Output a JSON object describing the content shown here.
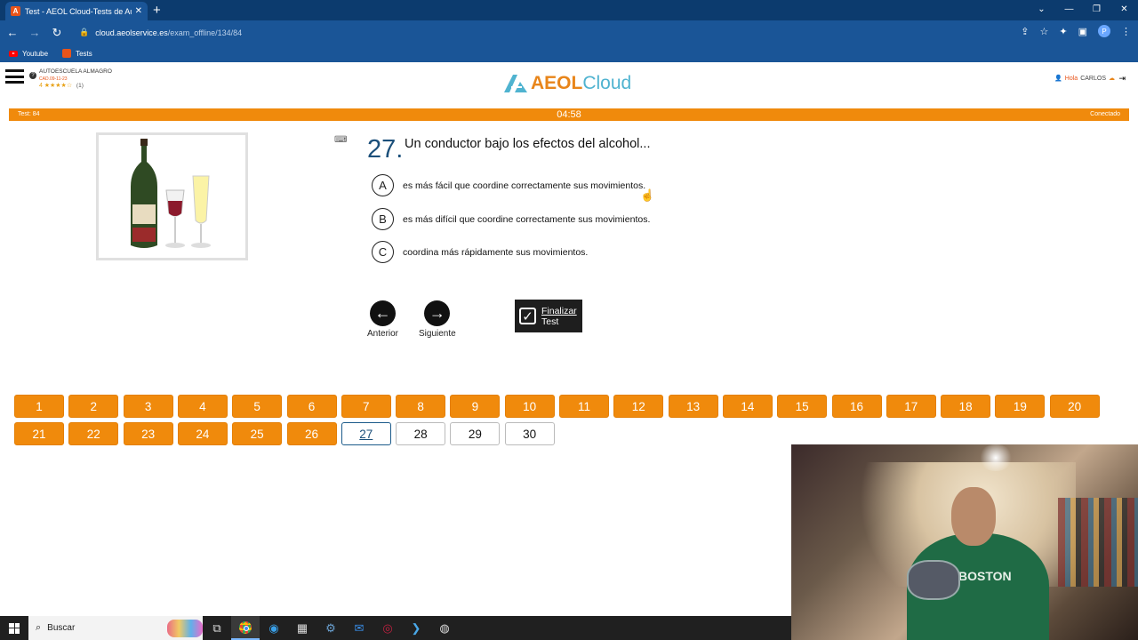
{
  "browser": {
    "tab_title": "Test - AEOL Cloud-Tests de Auto",
    "tab_close": "✕",
    "new_tab": "+",
    "url_host": "cloud.aeolservice.es",
    "url_path": "/exam_offline/134/84",
    "bookmarks": [
      {
        "label": "Youtube"
      },
      {
        "label": "Tests"
      }
    ],
    "window_controls": [
      "⌄",
      "—",
      "❐",
      "✕"
    ]
  },
  "header": {
    "school_name": "AUTOESCUELA ALMAGRO",
    "school_code": "CAD.09-11-23",
    "rating_value": "4",
    "rating_stars": "★★★★☆",
    "rating_count": "(1)",
    "logo_a": "AEOL",
    "logo_cloud": "Cloud",
    "greeting_prefix": "Hola",
    "user_name": "CARLOS"
  },
  "status": {
    "test_label": "Test: 84",
    "timer": "04:58",
    "connection": "Conectado"
  },
  "question": {
    "number": "27.",
    "text": "Un conductor bajo los efectos del alcohol...",
    "options": [
      {
        "letter": "A",
        "text": "es más fácil que coordine correctamente sus movimientos."
      },
      {
        "letter": "B",
        "text": "es más difícil que coordine correctamente sus movimientos."
      },
      {
        "letter": "C",
        "text": "coordina más rápidamente sus movimientos."
      }
    ]
  },
  "navigation": {
    "prev_label": "Anterior",
    "next_label": "Siguiente",
    "finish_line1": "Finalizar",
    "finish_line2": "Test"
  },
  "question_grid": {
    "answered": [
      "1",
      "2",
      "3",
      "4",
      "5",
      "6",
      "7",
      "8",
      "9",
      "10",
      "11",
      "12",
      "13",
      "14",
      "15",
      "16",
      "17",
      "18",
      "19",
      "20",
      "21",
      "22",
      "23",
      "24",
      "25",
      "26"
    ],
    "current": "27",
    "pending": [
      "28",
      "29",
      "30"
    ]
  },
  "taskbar": {
    "search_label": "Buscar"
  },
  "webcam": {
    "shirt_text": "BOSTON"
  },
  "colors": {
    "accent_orange": "#f08a0c",
    "question_blue": "#1b4f7a",
    "browser_blue": "#1a5597"
  }
}
